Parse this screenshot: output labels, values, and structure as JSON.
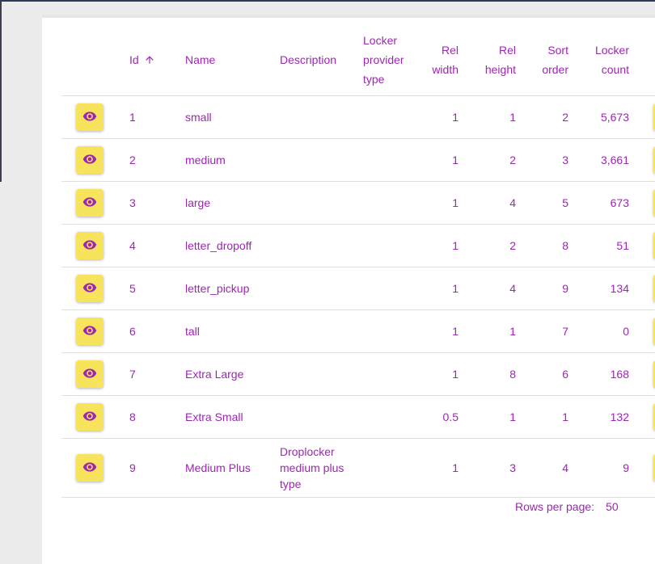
{
  "table": {
    "headers": {
      "id": "Id",
      "name": "Name",
      "description": "Description",
      "locker_provider_type": "Locker provider type",
      "rel_width": "Rel width",
      "rel_height": "Rel height",
      "sort_order": "Sort order",
      "locker_count": "Locker count"
    },
    "rows": [
      {
        "id": "1",
        "name": "small",
        "description": "",
        "rel_width": "1",
        "rel_height": "1",
        "sort_order": "2",
        "locker_count": "5,673"
      },
      {
        "id": "2",
        "name": "medium",
        "description": "",
        "rel_width": "1",
        "rel_height": "2",
        "sort_order": "3",
        "locker_count": "3,661"
      },
      {
        "id": "3",
        "name": "large",
        "description": "",
        "rel_width": "1",
        "rel_height": "4",
        "sort_order": "5",
        "locker_count": "673"
      },
      {
        "id": "4",
        "name": "letter_dropoff",
        "description": "",
        "rel_width": "1",
        "rel_height": "2",
        "sort_order": "8",
        "locker_count": "51"
      },
      {
        "id": "5",
        "name": "letter_pickup",
        "description": "",
        "rel_width": "1",
        "rel_height": "4",
        "sort_order": "9",
        "locker_count": "134"
      },
      {
        "id": "6",
        "name": "tall",
        "description": "",
        "rel_width": "1",
        "rel_height": "1",
        "sort_order": "7",
        "locker_count": "0"
      },
      {
        "id": "7",
        "name": "Extra Large",
        "description": "",
        "rel_width": "1",
        "rel_height": "8",
        "sort_order": "6",
        "locker_count": "168"
      },
      {
        "id": "8",
        "name": "Extra Small",
        "description": "",
        "rel_width": "0.5",
        "rel_height": "1",
        "sort_order": "1",
        "locker_count": "132"
      },
      {
        "id": "9",
        "name": "Medium Plus",
        "description": "Droplocker medium plus type",
        "rel_width": "1",
        "rel_height": "3",
        "sort_order": "4",
        "locker_count": "9"
      }
    ]
  },
  "pagination": {
    "rows_per_page_label": "Rows per page:",
    "rows_per_page_value": "50"
  },
  "icons": {
    "view": "eye-icon",
    "sort": "arrow-up-icon"
  },
  "colors": {
    "accent": "#9c27b0",
    "button": "#f8e45c"
  }
}
